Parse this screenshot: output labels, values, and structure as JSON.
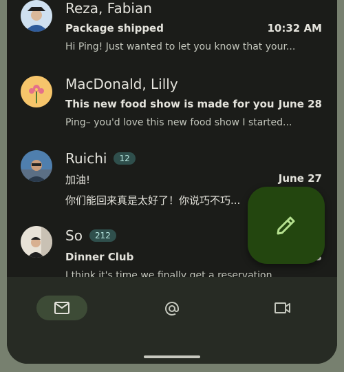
{
  "conversations": [
    {
      "name": "Reza, Fabian",
      "badge": "",
      "subject": "Package shipped",
      "time": "10:32 AM",
      "preview": "Hi Ping! Just wanted to let you know that your...",
      "avatar_colors": [
        "#3a5f9e",
        "#d9b89a"
      ]
    },
    {
      "name": "MacDonald, Lilly",
      "badge": "",
      "subject": "This new food show is made for you",
      "time": "June 28",
      "preview": "Ping– you'd love this new food show I started...",
      "avatar_colors": [
        "#f6c56b",
        "#e4708a"
      ]
    },
    {
      "name": "Ruichi",
      "badge": "12",
      "subject": "加油!",
      "time": "June 27",
      "preview": "你们能回来真是太好了！你说巧不巧...",
      "avatar_colors": [
        "#4f7fae",
        "#2a3a4c"
      ]
    },
    {
      "name": "So",
      "badge": "212",
      "subject": "Dinner Club",
      "time": "3",
      "preview": "I think it's time we finally get a reservation...",
      "avatar_colors": [
        "#e8e2d7",
        "#1f1f1f"
      ]
    }
  ],
  "nav": {
    "tabs": [
      {
        "icon": "mail-icon",
        "active": true
      },
      {
        "icon": "at-sign-icon",
        "active": false
      },
      {
        "icon": "video-icon",
        "active": false
      }
    ]
  },
  "fab": {
    "icon": "pencil-icon",
    "color": "#23460f"
  },
  "colors": {
    "background": "#1b1c19",
    "accent": "#b5e08f",
    "badge": "#2f4f4c"
  }
}
